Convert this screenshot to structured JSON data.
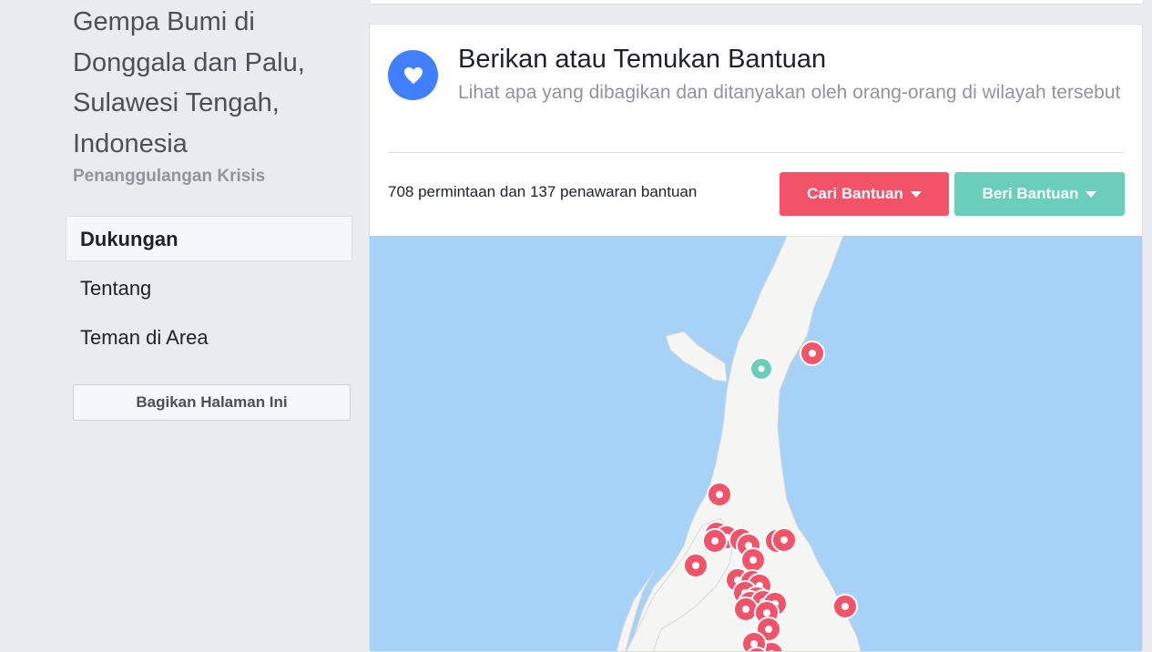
{
  "page": {
    "title": "Gempa Bumi di\nDonggala dan Palu,\nSulawesi Tengah,\nIndonesia",
    "category": "Penanggulangan Krisis"
  },
  "nav": {
    "items": [
      {
        "label": "Dukungan",
        "active": true
      },
      {
        "label": "Tentang",
        "active": false
      },
      {
        "label": "Teman di Area",
        "active": false
      }
    ],
    "share_label": "Bagikan Halaman Ini"
  },
  "card": {
    "icon": "heart-icon",
    "title": "Berikan atau Temukan Bantuan",
    "subtitle": "Lihat apa yang dibagikan dan ditanyakan oleh orang-orang di wilayah tersebut",
    "counts": "708 permintaan dan 137 penawaran bantuan",
    "request_button": "Cari Bantuan",
    "offer_button": "Beri Bantuan"
  },
  "colors": {
    "accent_blue": "#4080ff",
    "request_red": "#f35369",
    "offer_green": "#6bcebb",
    "water": "#a6d2f8",
    "land": "#f5f5f3"
  }
}
